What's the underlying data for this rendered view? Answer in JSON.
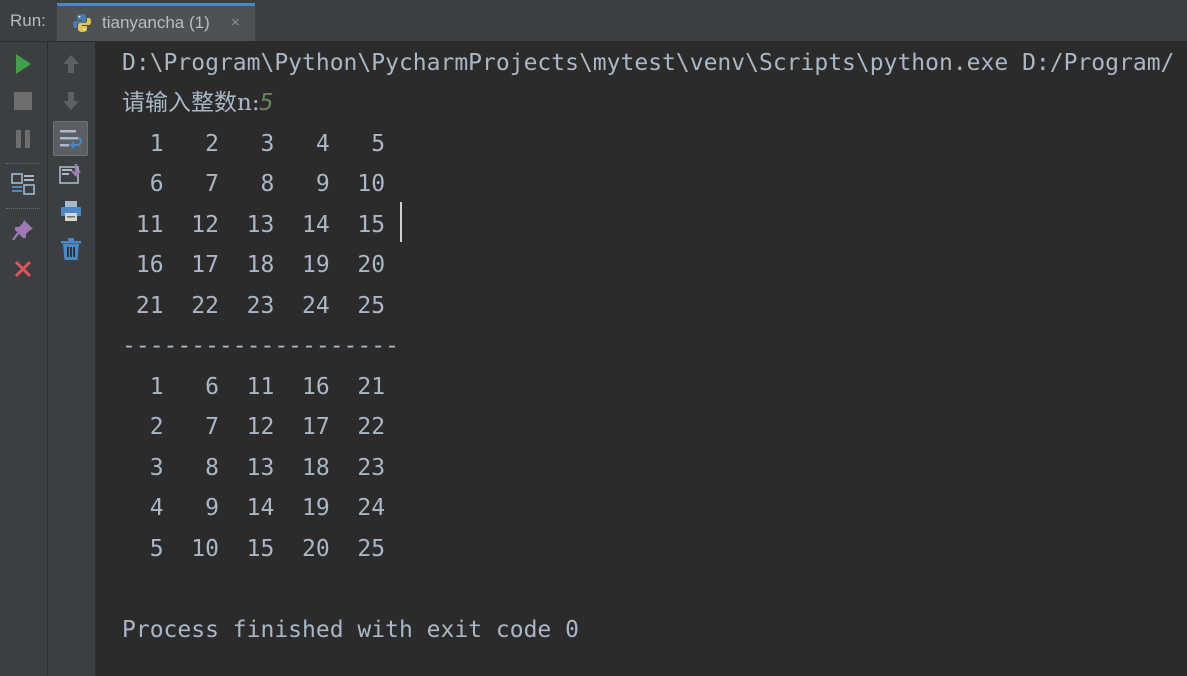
{
  "run_label": "Run:",
  "tab": {
    "title": "tianyancha (1)",
    "close_glyph": "×",
    "icon": "python-icon"
  },
  "toolbar_left": [
    "run-icon",
    "stop-icon",
    "pause-icon",
    "layout-icon",
    "pin-icon",
    "close-icon"
  ],
  "toolbar_right": [
    "up-arrow-icon",
    "down-arrow-icon",
    "soft-wrap-icon",
    "scroll-to-end-icon",
    "print-icon",
    "trash-icon"
  ],
  "colors": {
    "run_green": "#3fa04a",
    "close_red": "#e05555",
    "tab_accent": "#4a88c7",
    "input_green": "#6a8759",
    "text": "#a9b7c6"
  },
  "console": {
    "command_line": "D:\\Program\\Python\\PycharmProjects\\mytest\\venv\\Scripts\\python.exe D:/Program/",
    "prompt": "请输入整数n:",
    "input_value": "5",
    "rows": [
      "  1   2   3   4   5",
      "  6   7   8   9  10",
      " 11  12  13  14  15",
      " 16  17  18  19  20",
      " 21  22  23  24  25",
      "--------------------",
      "  1   6  11  16  21",
      "  2   7  12  17  22",
      "  3   8  13  18  23",
      "  4   9  14  19  24",
      "  5  10  15  20  25"
    ],
    "exit_message": "Process finished with exit code 0"
  }
}
